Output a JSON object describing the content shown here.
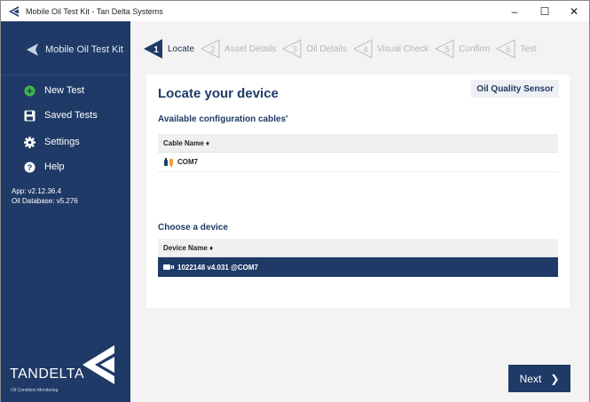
{
  "window": {
    "title": "Mobile Oil Test Kit - Tan Delta Systems",
    "minimize_glyph": "–",
    "maximize_glyph": "☐",
    "close_glyph": "✕"
  },
  "sidebar": {
    "app_name": "Mobile Oil Test Kit",
    "items": [
      {
        "label": "New Test",
        "icon": "plus-circle-icon"
      },
      {
        "label": "Saved Tests",
        "icon": "floppy-disk-icon"
      },
      {
        "label": "Settings",
        "icon": "gear-icon"
      },
      {
        "label": "Help",
        "icon": "question-circle-icon"
      }
    ],
    "app_version": "App: v2.12.36.4",
    "db_version": "Oil Database: v5.276",
    "brand": "TANDELTA",
    "brand_tagline": "Oil Condition Monitoring"
  },
  "stepper": {
    "steps": [
      {
        "number": "1",
        "label": "Locate",
        "active": true
      },
      {
        "number": "2",
        "label": "Asset Details",
        "active": false
      },
      {
        "number": "3",
        "label": "Oil Details",
        "active": false
      },
      {
        "number": "4",
        "label": "Visual Check",
        "active": false
      },
      {
        "number": "5",
        "label": "Confirm",
        "active": false
      },
      {
        "number": "6",
        "label": "Test",
        "active": false
      }
    ]
  },
  "main": {
    "title": "Locate your device",
    "sensor_badge": "Oil Quality Sensor",
    "cables_title": "Available configuration cables'",
    "cables_header": "Cable Name ♦",
    "cables": [
      "COM7"
    ],
    "devices_title": "Choose a device",
    "devices_header": "Device Name ♦",
    "devices": [
      "1022148 v4.031 @COM7"
    ],
    "next_label": "Next",
    "next_chevron": "❯"
  },
  "colors": {
    "sidebar": "#1f3a66",
    "accent_green": "#3db54a",
    "selected_row": "#1f3a66"
  }
}
